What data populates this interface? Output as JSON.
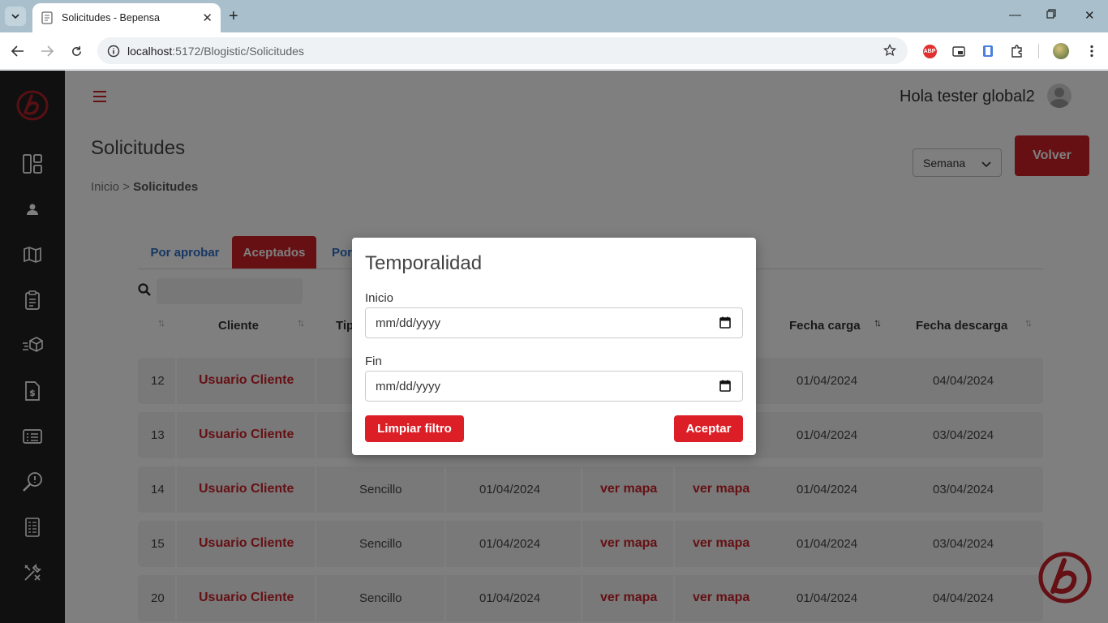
{
  "browser": {
    "tab_title": "Solicitudes - Bepensa",
    "url_host": "localhost",
    "url_path": ":5172/Blogistic/Solicitudes",
    "ext_abp": "ABP"
  },
  "header": {
    "greeting": "Hola tester global2"
  },
  "page": {
    "title": "Solicitudes",
    "breadcrumb_home": "Inicio",
    "breadcrumb_sep": ">",
    "breadcrumb_current": "Solicitudes",
    "period_select": "Semana",
    "back_button": "Volver"
  },
  "tabs": [
    {
      "label": "Por aprobar"
    },
    {
      "label": "Aceptados"
    },
    {
      "label": "Por"
    }
  ],
  "table": {
    "columns": [
      "Cliente",
      "Tip",
      "Fecha carga",
      "Fecha descarga"
    ],
    "rows": [
      {
        "id": "12",
        "cliente": "Usuario Cliente",
        "tipo": "",
        "fecha": "",
        "origen": "",
        "destino": "",
        "carga": "01/04/2024",
        "descarga": "04/04/2024"
      },
      {
        "id": "13",
        "cliente": "Usuario Cliente",
        "tipo": "",
        "fecha": "",
        "origen": "",
        "destino": "",
        "carga": "01/04/2024",
        "descarga": "03/04/2024"
      },
      {
        "id": "14",
        "cliente": "Usuario Cliente",
        "tipo": "Sencillo",
        "fecha": "01/04/2024",
        "origen": "ver mapa",
        "destino": "ver mapa",
        "carga": "01/04/2024",
        "descarga": "03/04/2024"
      },
      {
        "id": "15",
        "cliente": "Usuario Cliente",
        "tipo": "Sencillo",
        "fecha": "01/04/2024",
        "origen": "ver mapa",
        "destino": "ver mapa",
        "carga": "01/04/2024",
        "descarga": "03/04/2024"
      },
      {
        "id": "20",
        "cliente": "Usuario Cliente",
        "tipo": "Sencillo",
        "fecha": "01/04/2024",
        "origen": "ver mapa",
        "destino": "ver mapa",
        "carga": "01/04/2024",
        "descarga": "04/04/2024"
      }
    ]
  },
  "modal": {
    "title": "Temporalidad",
    "start_label": "Inicio",
    "start_placeholder": "mm/dd/yyyy",
    "end_label": "Fin",
    "end_placeholder": "mm/dd/yyyy",
    "clear_button": "Limpiar filtro",
    "accept_button": "Aceptar"
  },
  "colors": {
    "brand_red": "#cc2128",
    "sidebar_bg": "#202020",
    "tab_blue": "#2c6fc9"
  },
  "icons": [
    "hamburger-icon",
    "dashboard-icon",
    "user-icon",
    "map-icon",
    "clipboard-icon",
    "package-icon",
    "invoice-icon",
    "list-icon",
    "search-key-icon",
    "report-icon",
    "tools-icon"
  ]
}
